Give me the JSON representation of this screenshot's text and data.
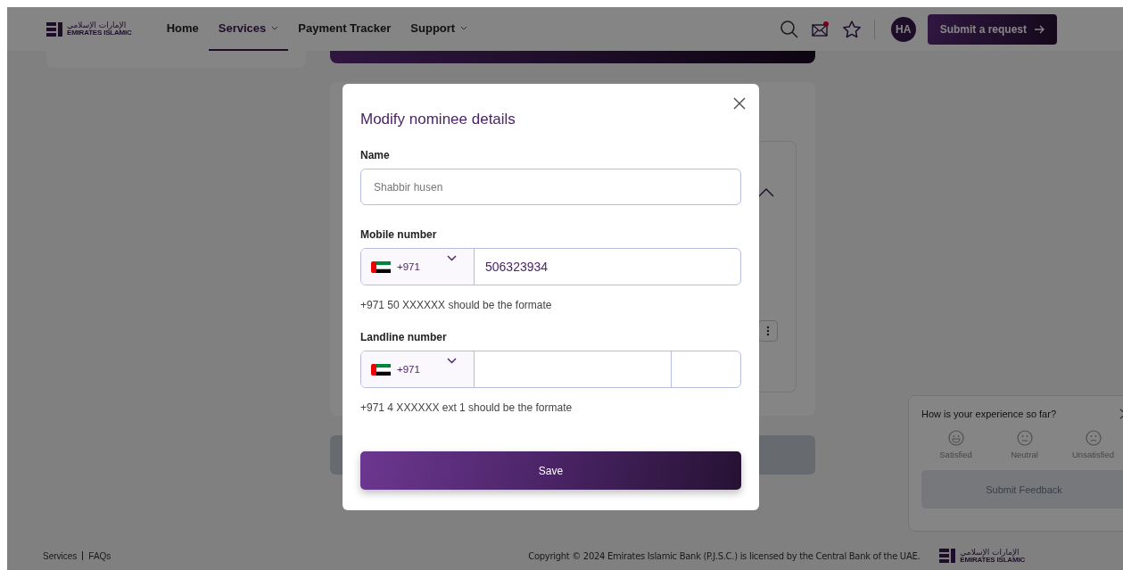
{
  "header": {
    "logo": {
      "arabic": "الإمارات الإسلامي",
      "latin": "EMIRATES ISLAMIC"
    },
    "nav": [
      {
        "label": "Home",
        "selected": false,
        "dropdown": false
      },
      {
        "label": "Services",
        "selected": true,
        "dropdown": true
      },
      {
        "label": "Payment Tracker",
        "selected": false,
        "dropdown": false
      },
      {
        "label": "Support",
        "selected": false,
        "dropdown": true
      }
    ],
    "mail_unread": true,
    "avatar": "HA",
    "submit_button": "Submit a request"
  },
  "dialog": {
    "title": "Modify nominee details",
    "fields": [
      {
        "kind": "text",
        "label": "Name",
        "value": "Shabbir husen",
        "readonly": true
      },
      {
        "kind": "phone",
        "label": "Mobile number",
        "code": "+971",
        "value": "506323934",
        "extension": false,
        "hint": "+971 50 XXXXXX should be the formate"
      },
      {
        "kind": "phone",
        "label": "Landline number",
        "code": "+971",
        "extension": true,
        "hint": "+971 4 XXXXXX ext 1 should be the formate"
      }
    ],
    "save_button": "Save"
  },
  "feedback": {
    "question": "How is your experience so far?",
    "options": [
      {
        "kind": "happy",
        "label": "Satisfied"
      },
      {
        "kind": "neutral",
        "label": "Neutral"
      },
      {
        "kind": "sad",
        "label": "Unsatisfied"
      }
    ],
    "submit_button": "Submit Feedback",
    "disabled": true
  },
  "footer": {
    "links": [
      "Services",
      "FAQs"
    ],
    "copyright": "Copyright © 2024 Emirates Islamic Bank (P.J.S.C.) is licensed by the Central Bank of the UAE.",
    "logo": {
      "arabic": "الإمارات الإسلامي",
      "latin": "EMIRATES ISLAMIC"
    }
  }
}
